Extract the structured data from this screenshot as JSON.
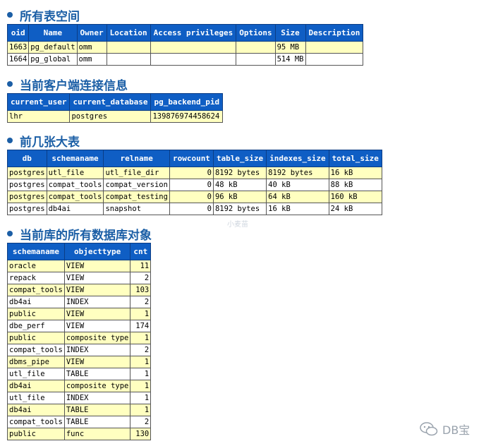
{
  "sections": [
    {
      "title": "所有表空间",
      "columns": [
        "oid",
        "Name",
        "Owner",
        "Location",
        "Access privileges",
        "Options",
        "Size",
        "Description"
      ],
      "rows": [
        [
          "1663",
          "pg_default",
          "omm",
          "",
          "",
          "",
          "95 MB",
          ""
        ],
        [
          "1664",
          "pg_global",
          "omm",
          "",
          "",
          "",
          "514 MB",
          ""
        ]
      ]
    },
    {
      "title": "当前客户端连接信息",
      "columns": [
        "current_user",
        "current_database",
        "pg_backend_pid"
      ],
      "rows": [
        [
          "lhr",
          "postgres",
          "139876974458624"
        ]
      ]
    },
    {
      "title": "前几张大表",
      "columns": [
        "db",
        "schemaname",
        "relname",
        "rowcount",
        "table_size",
        "indexes_size",
        "total_size"
      ],
      "rows": [
        [
          "postgres",
          "utl_file",
          "utl_file_dir",
          "0",
          "8192 bytes",
          "8192 bytes",
          "16 kB"
        ],
        [
          "postgres",
          "compat_tools",
          "compat_version",
          "0",
          "48 kB",
          "40 kB",
          "88 kB"
        ],
        [
          "postgres",
          "compat_tools",
          "compat_testing",
          "0",
          "96 kB",
          "64 kB",
          "160 kB"
        ],
        [
          "postgres",
          "db4ai",
          "snapshot",
          "0",
          "8192 bytes",
          "16 kB",
          "24 kB"
        ]
      ]
    },
    {
      "title": "当前库的所有数据库对象",
      "columns": [
        "schemaname",
        "objecttype",
        "cnt"
      ],
      "rows": [
        [
          "oracle",
          "VIEW",
          "11"
        ],
        [
          "repack",
          "VIEW",
          "2"
        ],
        [
          "compat_tools",
          "VIEW",
          "103"
        ],
        [
          "db4ai",
          "INDEX",
          "2"
        ],
        [
          "public",
          "VIEW",
          "1"
        ],
        [
          "dbe_perf",
          "VIEW",
          "174"
        ],
        [
          "public",
          "composite type",
          "1"
        ],
        [
          "compat_tools",
          "INDEX",
          "2"
        ],
        [
          "dbms_pipe",
          "VIEW",
          "1"
        ],
        [
          "utl_file",
          "TABLE",
          "1"
        ],
        [
          "db4ai",
          "composite type",
          "1"
        ],
        [
          "utl_file",
          "INDEX",
          "1"
        ],
        [
          "db4ai",
          "TABLE",
          "1"
        ],
        [
          "compat_tools",
          "TABLE",
          "2"
        ],
        [
          "public",
          "func",
          "130"
        ]
      ]
    }
  ],
  "watermark_mid": "小麦苗",
  "logo_text": "DB宝",
  "colors": {
    "heading": "#1c5fa6",
    "header_bg": "#0f5ec4",
    "row_alt": "#ffffc0"
  }
}
